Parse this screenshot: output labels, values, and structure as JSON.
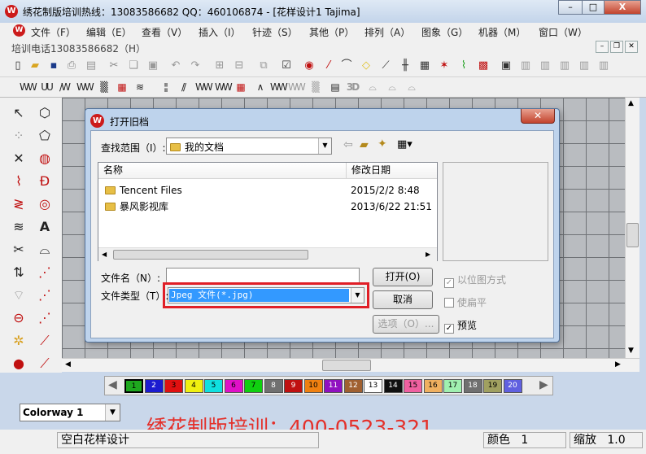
{
  "app": {
    "title": "绣花制版培训热线：13083586682 QQ：460106874 - [花样设计1         Tajima]"
  },
  "window_controls": {
    "min": "–",
    "max": "□",
    "close": "X"
  },
  "menu": [
    "文件（F）",
    "编辑（E）",
    "查看（V）",
    "插入（I）",
    "针迹（S）",
    "其他（P）",
    "排列（A）",
    "图象（G）",
    "机器（M）",
    "窗口（W）"
  ],
  "doc_title": "培训电话13083586682（H）",
  "dialog": {
    "title": "打开旧档",
    "look_in_label": "查找范围（I）:",
    "look_in_value": "我的文档",
    "columns": {
      "name": "名称",
      "date": "修改日期"
    },
    "files": [
      {
        "name": "Tencent Files",
        "date": "2015/2/2 8:48"
      },
      {
        "name": "暴风影视库",
        "date": "2013/6/22 21:51"
      }
    ],
    "filename_label": "文件名（N）:",
    "filename_value": "",
    "filetype_label": "文件类型（T）:",
    "filetype_value": "Jpeg 文件(*.jpg)",
    "open_btn": "打开(O)",
    "cancel_btn": "取消",
    "options_btn": "选项（O）...",
    "bitmap_mode": "以位图方式",
    "flatten": "使扁平",
    "preview": "预览"
  },
  "palette": [
    "1",
    "2",
    "3",
    "4",
    "5",
    "6",
    "7",
    "8",
    "9",
    "10",
    "11",
    "12",
    "13",
    "14",
    "15",
    "16",
    "17",
    "18",
    "19",
    "20"
  ],
  "palette_colors": [
    "#1ea81e",
    "#1b1bd0",
    "#e01010",
    "#f0f010",
    "#10e0e0",
    "#e010c8",
    "#10d010",
    "#707070",
    "#c01010",
    "#f08010",
    "#9010c0",
    "#a06030",
    "#ffffff",
    "#101010",
    "#f060a0",
    "#f0b060",
    "#a0f0b0",
    "#707070",
    "#a0a060",
    "#6060e0"
  ],
  "colorway": "Colorway 1",
  "promo": "绣花制版培训：400-0523-321",
  "status": {
    "pattern": "空白花样设计",
    "color_label": "颜色",
    "color_value": "1",
    "zoom_label": "缩放",
    "zoom_value": "1.0"
  }
}
